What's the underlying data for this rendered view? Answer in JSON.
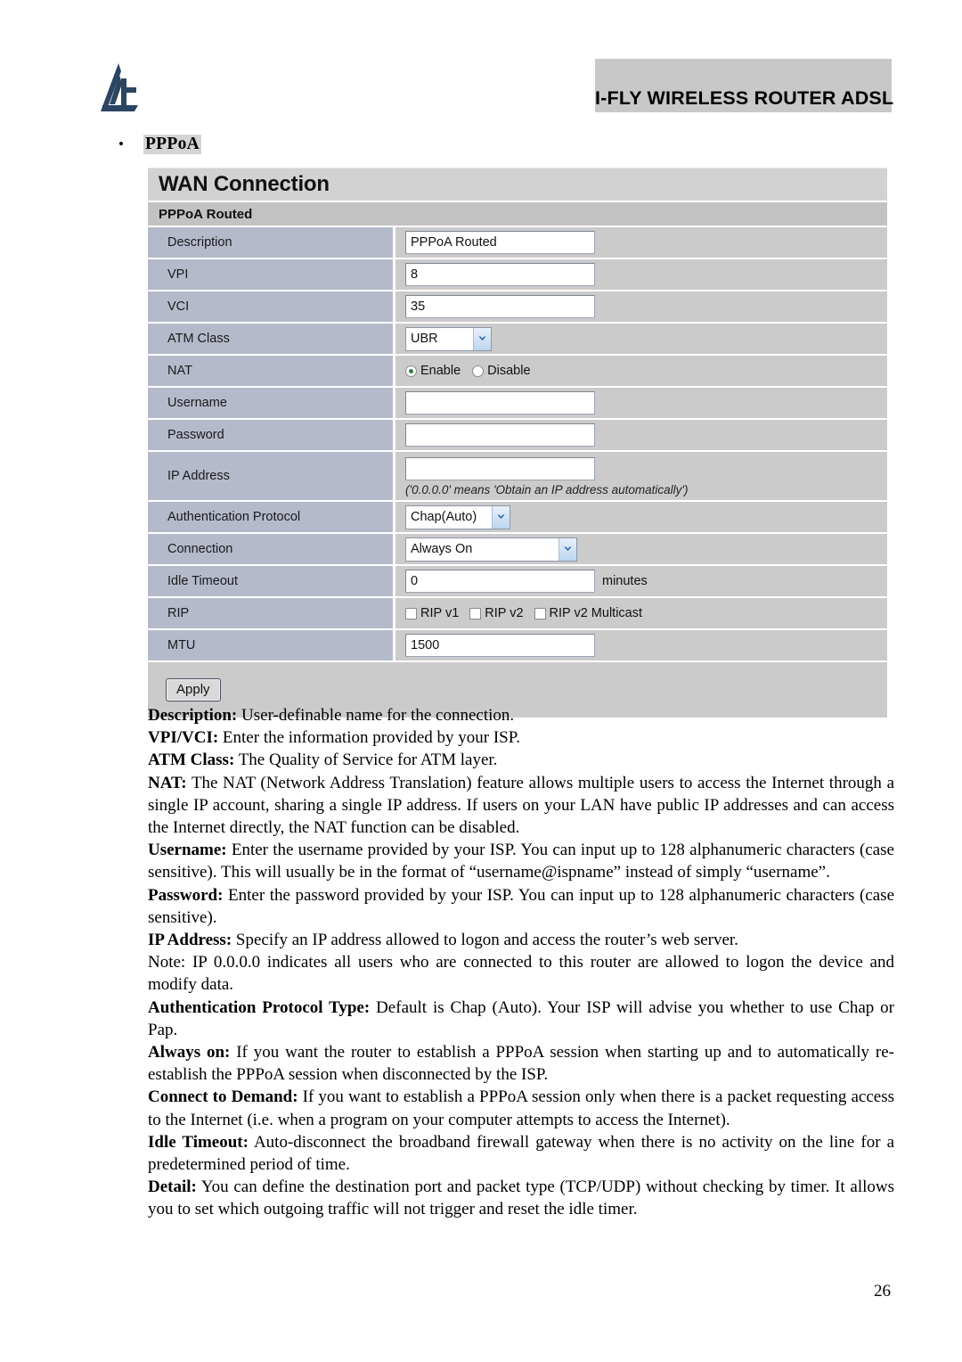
{
  "header": {
    "banner_title": "I-FLY WIRELESS ROUTER ADSL",
    "logo_name": "atlantis-land-logo"
  },
  "section": {
    "bullet": "•",
    "heading": "PPPoA"
  },
  "router_ui": {
    "title": "WAN Connection",
    "subtitle": "PPPoA Routed",
    "rows": [
      {
        "label": "Description",
        "type": "text",
        "value": "PPPoA Routed"
      },
      {
        "label": "VPI",
        "type": "text",
        "value": "8"
      },
      {
        "label": "VCI",
        "type": "text",
        "value": "35"
      },
      {
        "label": "ATM Class",
        "type": "select",
        "value": "UBR"
      },
      {
        "label": "NAT",
        "type": "radio",
        "options": [
          "Enable",
          "Disable"
        ],
        "selected": "Enable"
      },
      {
        "label": "Username",
        "type": "text",
        "value": ""
      },
      {
        "label": "Password",
        "type": "text",
        "value": ""
      },
      {
        "label": "IP Address",
        "type": "text",
        "value": "",
        "hint": "('0.0.0.0' means 'Obtain an IP address automatically')"
      },
      {
        "label": "Authentication Protocol",
        "type": "select",
        "value": "Chap(Auto)"
      },
      {
        "label": "Connection",
        "type": "select",
        "value": "Always On"
      },
      {
        "label": "Idle Timeout",
        "type": "text",
        "value": "0",
        "unit": "minutes"
      },
      {
        "label": "RIP",
        "type": "checkbox",
        "options": [
          "RIP v1",
          "RIP v2",
          "RIP v2 Multicast"
        ],
        "checked": []
      },
      {
        "label": "MTU",
        "type": "text",
        "value": "1500"
      }
    ],
    "apply_label": "Apply"
  },
  "descriptions": [
    {
      "term": "Description:",
      "text": " User-definable name for the connection."
    },
    {
      "term": "VPI/VCI:",
      "text": " Enter the information provided by your ISP."
    },
    {
      "term": "ATM Class:",
      "text": " The Quality of Service for ATM layer."
    },
    {
      "term": "NAT:",
      "text": " The NAT (Network Address Translation) feature allows multiple users to access the Internet through a single IP account, sharing a single IP address. If users on your LAN have public IP addresses and can access the Internet directly, the NAT function can be disabled."
    },
    {
      "term": "Username:",
      "text": " Enter the username provided by your ISP. You can input up to 128 alphanumeric characters (case sensitive). This will usually be in the format of “username@ispname” instead of simply “username”."
    },
    {
      "term": "Password:",
      "text": " Enter the password provided by your ISP. You can input up to 128 alphanumeric characters (case sensitive)."
    },
    {
      "term": "IP Address:",
      "text": " Specify an IP address allowed to logon and access the router’s web server."
    },
    {
      "term": "",
      "text": "Note: IP 0.0.0.0 indicates all users who are connected to this router are allowed to logon the device and modify data."
    },
    {
      "term": "Authentication Protocol Type:",
      "text": " Default is Chap (Auto). Your ISP will advise you whether to use Chap or Pap."
    },
    {
      "term": "Always on:",
      "text": " If you want the router to establish a PPPoA session when starting up and to automatically re-establish the PPPoA session when disconnected by the ISP."
    },
    {
      "term": "Connect to Demand:",
      "text": " If you want to establish a PPPoA session only when there is a packet requesting access to the Internet (i.e. when a program on your computer attempts to access the Internet)."
    },
    {
      "term": "Idle Timeout:",
      "text": " Auto-disconnect the broadband firewall gateway when there is no activity on the line for a predetermined period of time."
    },
    {
      "term": "Detail:",
      "text": " You can define the destination port and packet type (TCP/UDP) without checking by timer. It allows you to set which outgoing traffic will not trigger and reset the idle timer."
    }
  ],
  "footer": {
    "page_number": "26"
  },
  "colors": {
    "banner_bg": "#c8c8c8",
    "label_col": "#b5bacb",
    "value_col": "#cbcbcb",
    "title_bar": "#d2d2d2",
    "subheader": "#c2c2c2",
    "logo": "#2b4563"
  }
}
